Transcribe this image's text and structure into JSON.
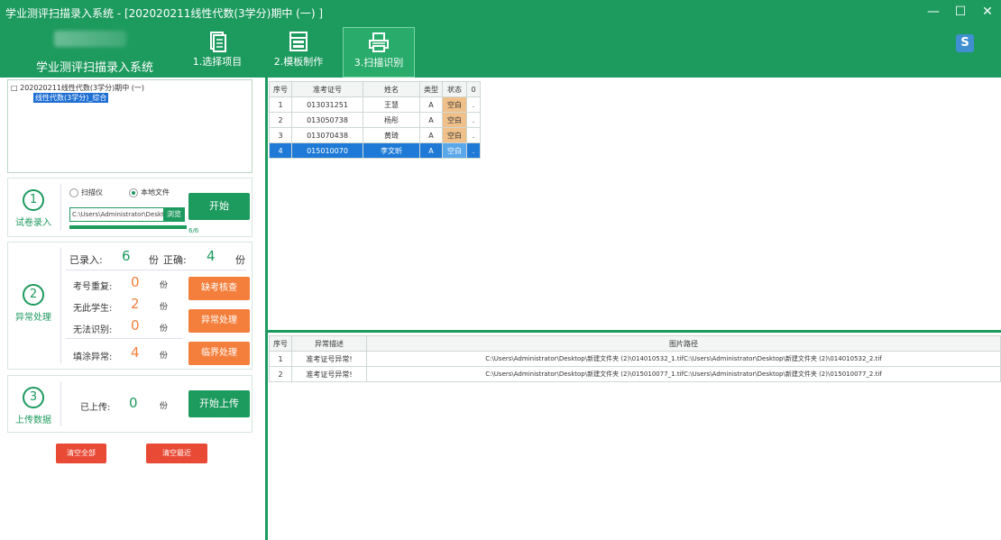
{
  "window": {
    "title": "学业测评扫描录入系统 - [202020211线性代数(3学分)期中 (一) ]",
    "controls": [
      "—",
      "☐",
      "✕"
    ]
  },
  "header": {
    "app_title": "学业测评扫描录入系统",
    "nav": [
      {
        "label": "1.选择项目",
        "icon": "document-icon"
      },
      {
        "label": "2.模板制作",
        "icon": "template-icon"
      },
      {
        "label": "3.扫描识别",
        "icon": "printer-icon"
      }
    ],
    "corner_glyph": "S"
  },
  "tree": {
    "root": "□ 202020211线性代数(3学分)期中 (一)",
    "child": "线性代数(3学分)_综合"
  },
  "step1": {
    "number": "1",
    "label": "试卷录入",
    "radio_scanner": "扫描仪",
    "radio_local": "本地文件",
    "path_value": "C:\\Users\\Administrator\\Desktop",
    "browse_label": "浏览",
    "start_label": "开始",
    "progress": 1.0,
    "progress_text": "6/6"
  },
  "step2": {
    "number": "2",
    "label": "异常处理",
    "recorded_label": "已录入:",
    "recorded_value": "6",
    "recorded_unit": "份",
    "correct_label": "正确:",
    "correct_value": "4",
    "correct_unit": "份",
    "rows": [
      {
        "label": "考号重复:",
        "value": "0",
        "unit": "份"
      },
      {
        "label": "无此学生:",
        "value": "2",
        "unit": "份"
      },
      {
        "label": "无法识别:",
        "value": "0",
        "unit": "份"
      },
      {
        "label": "填涂异常:",
        "value": "4",
        "unit": "份"
      }
    ],
    "btn_missing": "缺考核查",
    "btn_exception": "异常处理",
    "btn_critical": "临界处理"
  },
  "step3": {
    "number": "3",
    "label": "上传数据",
    "uploaded_label": "已上传:",
    "uploaded_value": "0",
    "uploaded_unit": "份",
    "upload_button": "开始上传"
  },
  "bottom_buttons": {
    "clear_all": "清空全部",
    "clear_recent": "清空最近"
  },
  "top_table": {
    "headers": [
      "序号",
      "准考证号",
      "姓名",
      "类型",
      "状态",
      "0"
    ],
    "rows": [
      [
        "1",
        "013031251",
        "王慧",
        "A",
        "空白",
        "."
      ],
      [
        "2",
        "013050738",
        "杨彤",
        "A",
        "空白",
        "."
      ],
      [
        "3",
        "013070438",
        "黄琦",
        "A",
        "空白",
        "."
      ],
      [
        "4",
        "015010070",
        "李文昕",
        "A",
        "空白",
        "."
      ]
    ],
    "selected_row": 4
  },
  "bottom_table": {
    "headers": [
      "序号",
      "异常描述",
      "图片路径"
    ],
    "rows": [
      [
        "1",
        "准考证号异常!",
        "C:\\Users\\Administrator\\Desktop\\新建文件夹 (2)\\014010532_1.tifC:\\Users\\Administrator\\Desktop\\新建文件夹 (2)\\014010532_2.tif"
      ],
      [
        "2",
        "准考证号异常!",
        "C:\\Users\\Administrator\\Desktop\\新建文件夹 (2)\\015010077_1.tifC:\\Users\\Administrator\\Desktop\\新建文件夹 (2)\\015010077_2.tif"
      ]
    ]
  },
  "colors": {
    "brand_green": "#1d9a5e",
    "orange": "#f47f3d",
    "red": "#e94a35",
    "selection_blue": "#1e7ad6",
    "status_tan": "#f0c08a"
  }
}
